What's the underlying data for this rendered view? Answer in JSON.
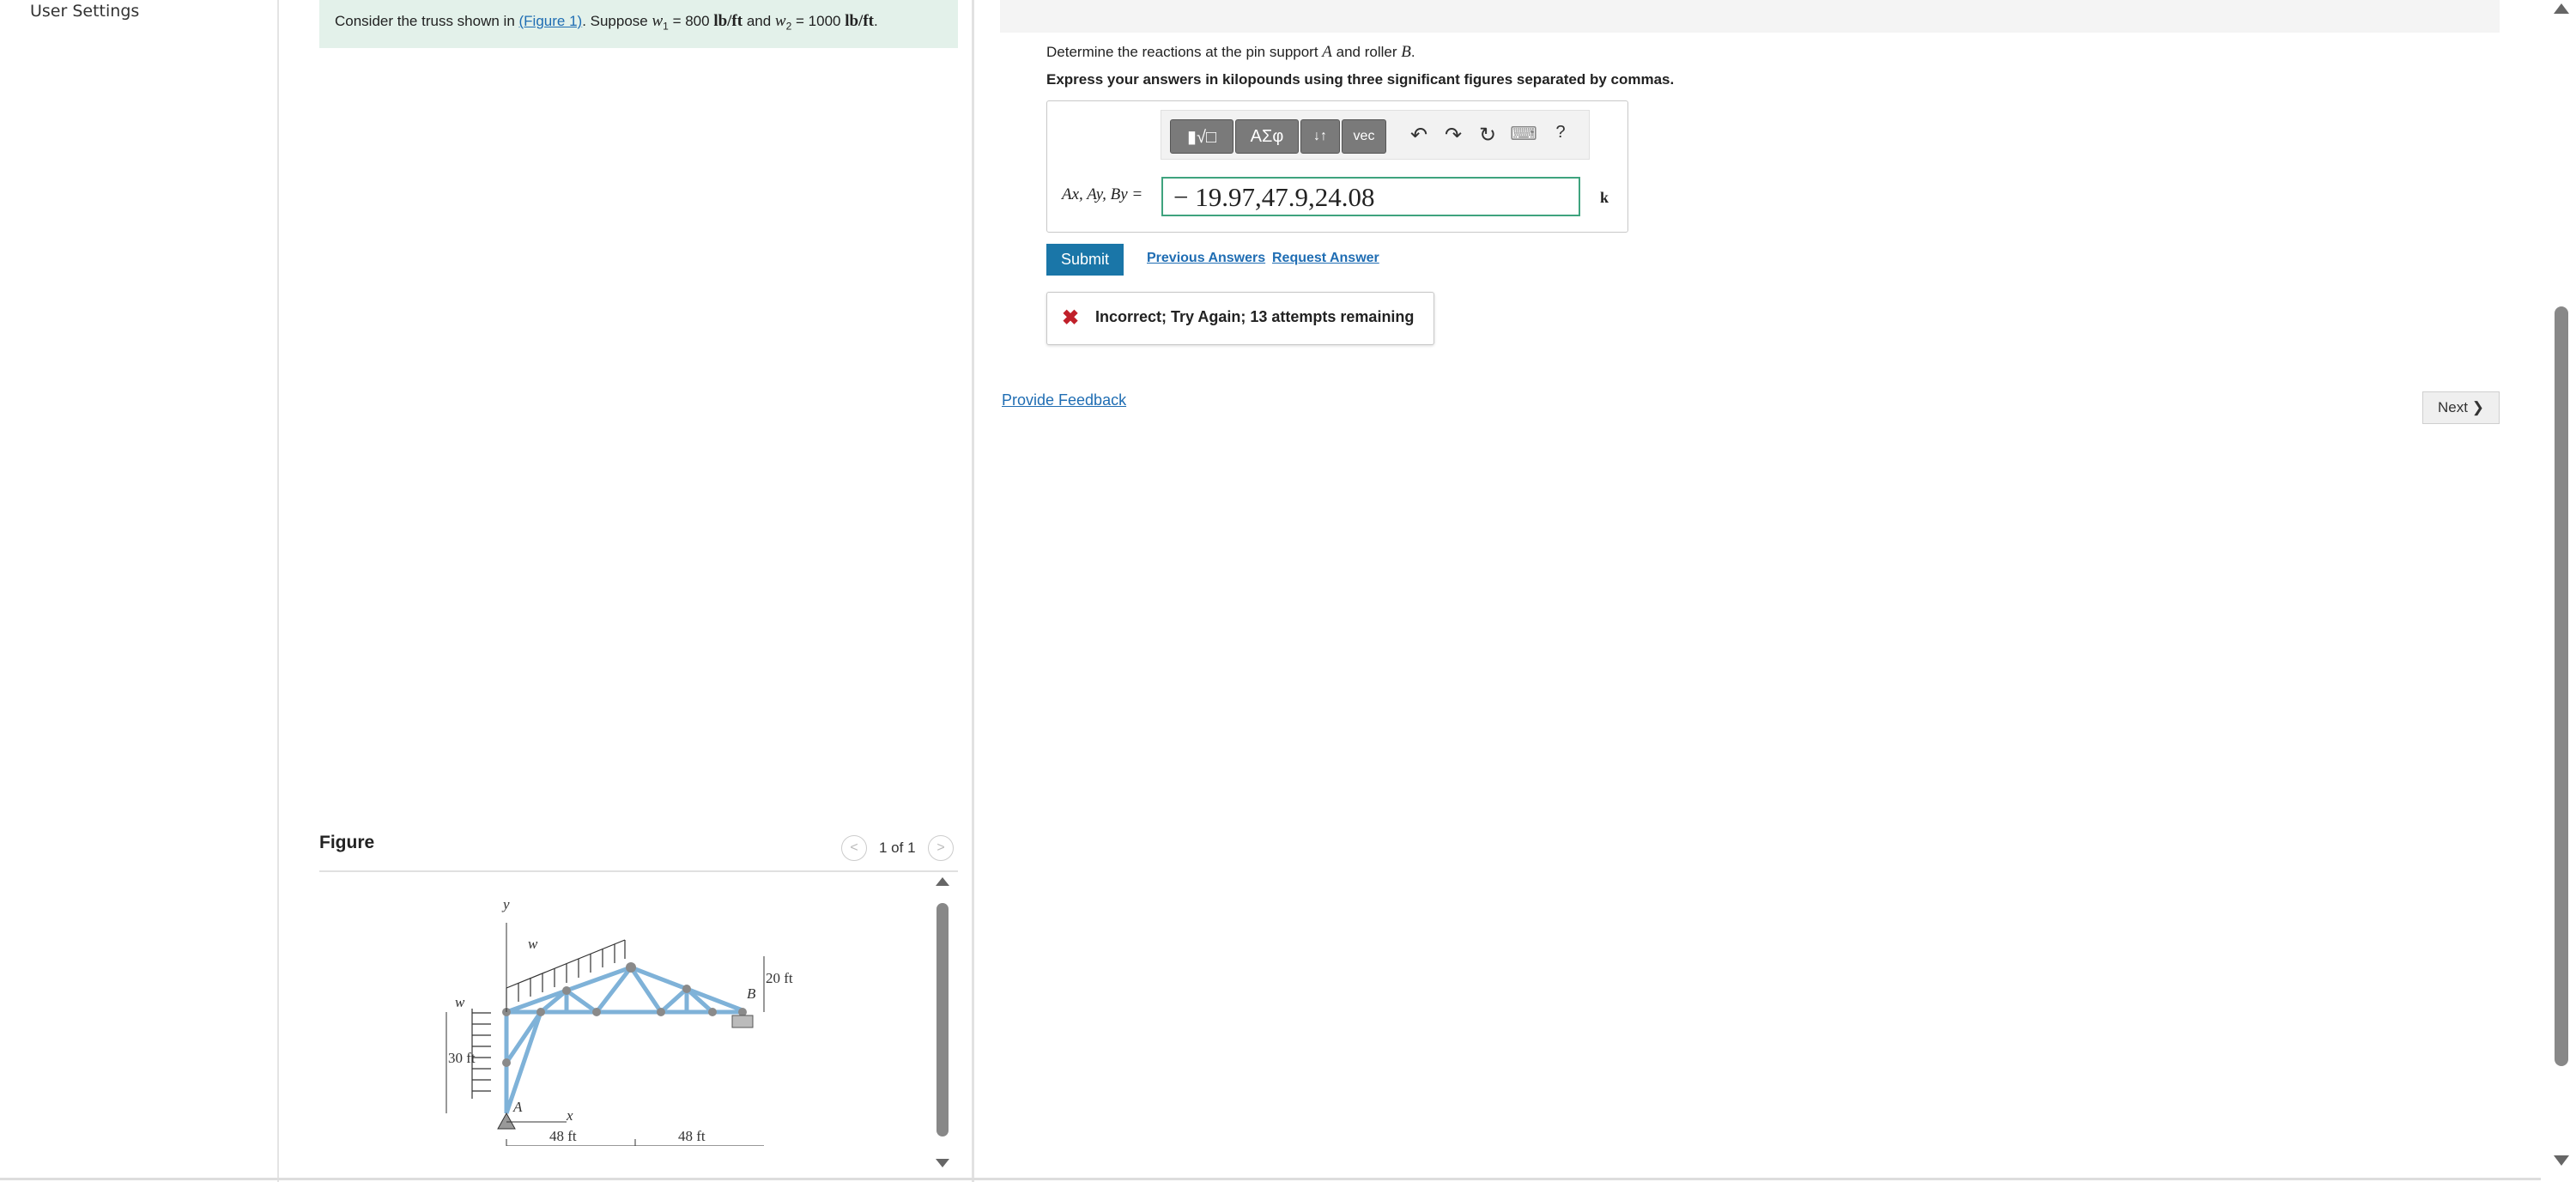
{
  "nav": {
    "user_settings": "User Settings"
  },
  "problem": {
    "prefix": "Consider the truss shown in ",
    "figure_link": "(Figure 1)",
    "middle": ". Suppose ",
    "w1_sym": "w",
    "w1_sub": "1",
    "w1_eq": " = 800 ",
    "w1_unit": "lb/ft",
    "and": " and ",
    "w2_sym": "w",
    "w2_sub": "2",
    "w2_eq": " = 1000 ",
    "w2_unit": "lb/ft",
    "end": "."
  },
  "figure": {
    "title": "Figure",
    "pager": "1 of 1",
    "prev": "<",
    "next": ">",
    "labels": {
      "y": "y",
      "x": "x",
      "w1": "w",
      "w1_sub": "1",
      "w2": "w",
      "w2_sub": "2",
      "dim_30": "30 ft",
      "dim_20": "20 ft",
      "dim_48a": "48 ft",
      "dim_48b": "48 ft",
      "A": "A",
      "B": "B"
    }
  },
  "question": {
    "prompt_a": "Determine the reactions at the pin support ",
    "A": "A",
    "prompt_b": " and roller ",
    "B": "B",
    "prompt_end": ".",
    "instruction": "Express your answers in kilopounds using three significant figures separated by commas."
  },
  "toolbar": {
    "templates": "▮√□",
    "greek": "ΑΣφ",
    "arrows": "↓↑",
    "vec": "vec",
    "undo": "↶",
    "redo": "↷",
    "reset": "↻",
    "keyboard": "⌨",
    "help": "?"
  },
  "answer": {
    "label": "Ax, Ay, By =",
    "value": "− 19.97,47.9,24.08",
    "unit": "k"
  },
  "actions": {
    "submit": "Submit",
    "previous_answers": "Previous Answers",
    "request_answer": "Request Answer"
  },
  "feedback": {
    "icon": "✖",
    "text": "Incorrect; Try Again; 13 attempts remaining"
  },
  "footer": {
    "provide_feedback": "Provide Feedback",
    "next": "Next ❯"
  },
  "colors": {
    "submit_bg": "#1a76a8",
    "link": "#1f6db3",
    "error": "#c0202a",
    "input_border": "#3fa37e",
    "banner_bg": "#e3f1ea"
  }
}
